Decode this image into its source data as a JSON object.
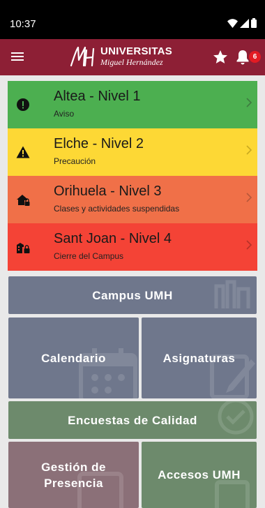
{
  "status_bar": {
    "time": "10:37"
  },
  "header": {
    "brand_line1": "UNIVERSITAS",
    "brand_line2": "Miguel Hernández",
    "notification_count": "6"
  },
  "alerts": [
    {
      "title": "Altea - Nivel 1",
      "subtitle": "Aviso",
      "color": "#4caf50"
    },
    {
      "title": "Elche - Nivel 2",
      "subtitle": "Precaución",
      "color": "#fdd835"
    },
    {
      "title": "Orihuela - Nivel 3",
      "subtitle": "Clases y actividades suspendidas",
      "color": "#f07048"
    },
    {
      "title": "Sant Joan - Nivel 4",
      "subtitle": "Cierre del Campus",
      "color": "#f44336"
    }
  ],
  "tiles": {
    "campus": "Campus UMH",
    "calendario": "Calendario",
    "asignaturas": "Asignaturas",
    "encuestas": "Encuestas de Calidad",
    "gestion_line1": "Gestión de",
    "gestion_line2": "Presencia",
    "accesos": "Accesos UMH"
  },
  "colors": {
    "brand": "#8d1f35",
    "tile_blue": "#6f778c",
    "tile_green": "#6d8a6c",
    "tile_mauve": "#8b7078"
  }
}
